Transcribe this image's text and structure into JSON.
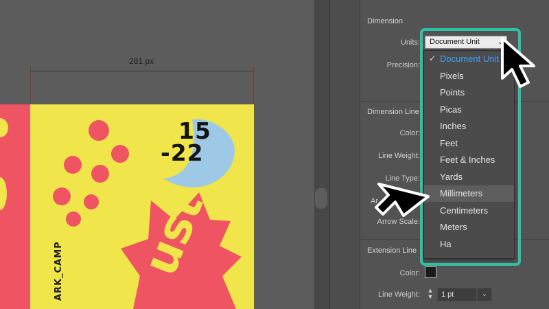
{
  "canvas": {
    "dimension_label": "281 px",
    "artwork": {
      "date_line1": "15",
      "date_line2": "-22",
      "vertical_text": "ARK_CAMP",
      "big_text": "ust",
      "colors": {
        "red": "#ee5462",
        "yellow": "#f0e54a",
        "blue": "#9ec9e6",
        "dark": "#141414"
      }
    }
  },
  "panel": {
    "dimension": {
      "title": "Dimension",
      "units_label": "Units:",
      "units_value": "Document Unit",
      "precision_label": "Precision:"
    },
    "dimension_line": {
      "title": "Dimension Line",
      "color_label": "Color:",
      "line_weight_label": "Line Weight:",
      "line_type_label": "Line Type:",
      "arrow_label": "Ar",
      "arrow_scale_label": "Arrow Scale:"
    },
    "extension_line": {
      "title": "Extension Line",
      "color_label": "Color:",
      "color_value": "#1a1a1a",
      "line_weight_label": "Line Weight:",
      "line_weight_value": "1 pt"
    }
  },
  "units_menu": {
    "selected": "Document Unit",
    "hovered": "Millimeters",
    "items": [
      "Document Unit",
      "Pixels",
      "Points",
      "Picas",
      "Inches",
      "Feet",
      "Feet & Inches",
      "Yards",
      "Millimeters",
      "Centimeters",
      "Meters",
      "Ha"
    ]
  },
  "theme": {
    "highlight": "#2fc1a3",
    "selected_text": "#3ea0ff"
  },
  "icons": {
    "check": "checkmark-icon",
    "select_chevron": "chevron-down-icon",
    "cursors": [
      "arrow-cursor-icon",
      "arrow-cursor-icon"
    ]
  }
}
